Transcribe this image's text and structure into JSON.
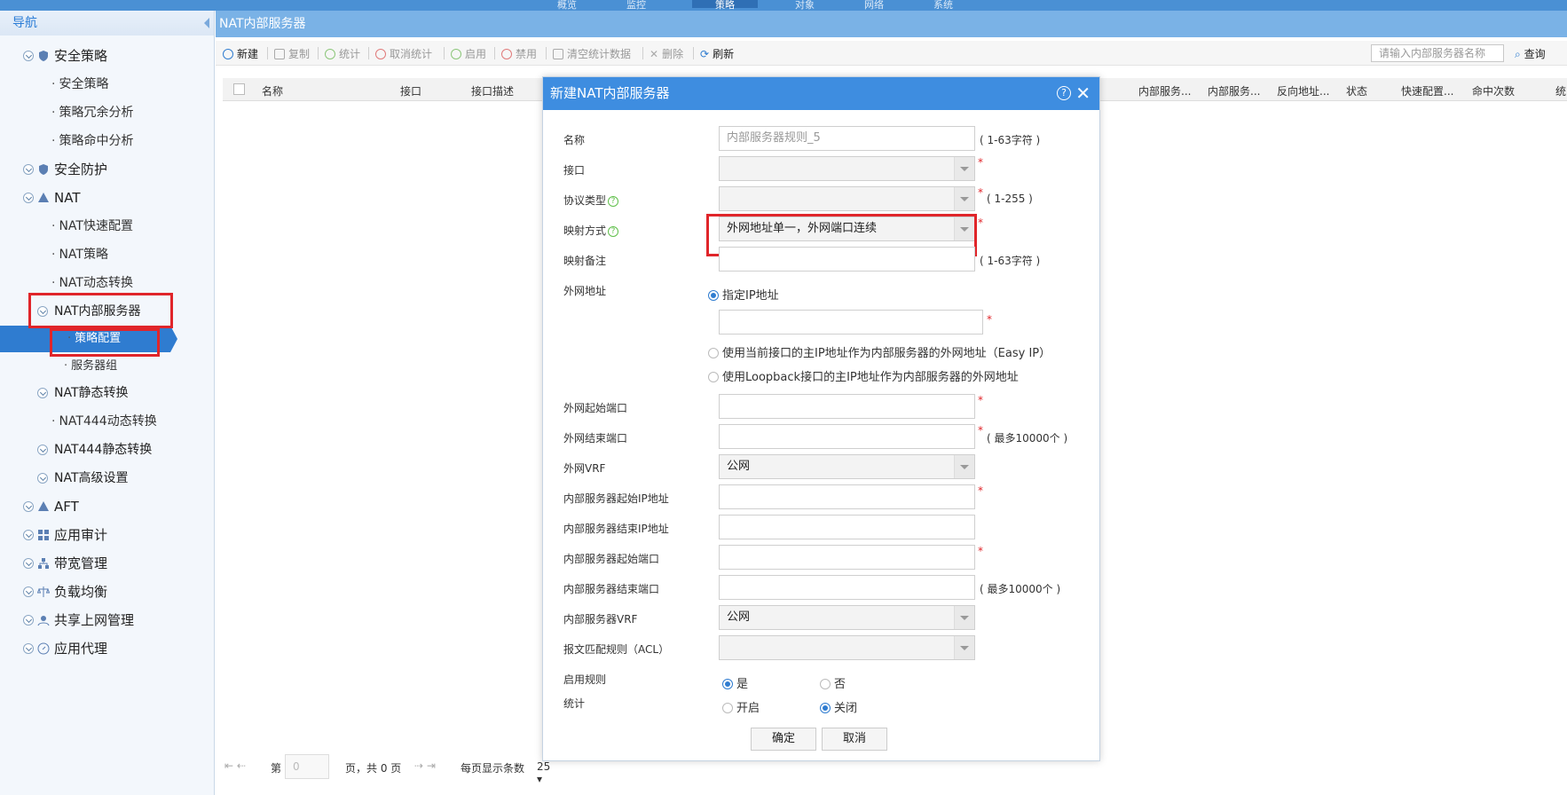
{
  "topnav": {
    "tabs": [
      "概览",
      "监控",
      "策略",
      "对象",
      "网络",
      "系统"
    ],
    "active_index": 2
  },
  "sidebar": {
    "header": "导航",
    "items": [
      {
        "label": "安全策略",
        "kind": "group"
      },
      {
        "label": "安全策略",
        "kind": "sub"
      },
      {
        "label": "策略冗余分析",
        "kind": "sub"
      },
      {
        "label": "策略命中分析",
        "kind": "sub"
      },
      {
        "label": "安全防护",
        "kind": "group"
      },
      {
        "label": "NAT",
        "kind": "group"
      },
      {
        "label": "NAT快速配置",
        "kind": "sub"
      },
      {
        "label": "NAT策略",
        "kind": "sub"
      },
      {
        "label": "NAT动态转换",
        "kind": "sub"
      },
      {
        "label": "NAT内部服务器",
        "kind": "sub-group"
      },
      {
        "label": "策略配置",
        "kind": "leaf",
        "active": true
      },
      {
        "label": "服务器组",
        "kind": "leaf"
      },
      {
        "label": "NAT静态转换",
        "kind": "sub-group"
      },
      {
        "label": "NAT444动态转换",
        "kind": "sub"
      },
      {
        "label": "NAT444静态转换",
        "kind": "sub-group"
      },
      {
        "label": "NAT高级设置",
        "kind": "sub-group"
      },
      {
        "label": "AFT",
        "kind": "group"
      },
      {
        "label": "应用审计",
        "kind": "group"
      },
      {
        "label": "带宽管理",
        "kind": "group"
      },
      {
        "label": "负载均衡",
        "kind": "group"
      },
      {
        "label": "共享上网管理",
        "kind": "group"
      },
      {
        "label": "应用代理",
        "kind": "group"
      }
    ]
  },
  "main": {
    "title": "NAT内部服务器",
    "toolbar": {
      "new": "新建",
      "copy": "复制",
      "stats": "统计",
      "cancel_stats": "取消统计",
      "enable": "启用",
      "disable": "禁用",
      "clear_stats": "清空统计数据",
      "delete": "删除",
      "refresh": "刷新",
      "search_placeholder": "请输入内部服务器名称",
      "query": "查询"
    },
    "columns": [
      "名称",
      "接口",
      "接口描述",
      "内部服务...",
      "内部服务...",
      "反向地址...",
      "状态",
      "快速配置...",
      "命中次数",
      "统"
    ],
    "pager": {
      "page_label": "第",
      "page_value": "0",
      "of_label": "页，共 0 页",
      "per_page_label": "每页显示条数",
      "per_page_value": "25"
    }
  },
  "dialog": {
    "title": "新建NAT内部服务器",
    "help": "?",
    "fields": {
      "name_label": "名称",
      "name_placeholder": "内部服务器规则_5",
      "name_hint": "( 1-63字符 )",
      "interface_label": "接口",
      "interface_value": "",
      "protocol_label": "协议类型",
      "protocol_value": "",
      "protocol_hint": "( 1-255 )",
      "mapping_label": "映射方式",
      "mapping_value": "外网地址单一，外网端口连续",
      "mapping_note_label": "映射备注",
      "mapping_note_value": "",
      "mapping_note_hint": "( 1-63字符 )",
      "ext_addr_label": "外网地址",
      "ext_addr_opt1": "指定IP地址",
      "ext_addr_value": "",
      "ext_addr_opt2": "使用当前接口的主IP地址作为内部服务器的外网地址（Easy IP）",
      "ext_addr_opt3": "使用Loopback接口的主IP地址作为内部服务器的外网地址",
      "ext_start_port_label": "外网起始端口",
      "ext_start_port_value": "",
      "ext_end_port_label": "外网结束端口",
      "ext_end_port_value": "",
      "ext_end_port_hint": "( 最多10000个 )",
      "ext_vrf_label": "外网VRF",
      "ext_vrf_value": "公网",
      "int_start_ip_label": "内部服务器起始IP地址",
      "int_start_ip_value": "",
      "int_end_ip_label": "内部服务器结束IP地址",
      "int_end_ip_value": "",
      "int_start_port_label": "内部服务器起始端口",
      "int_start_port_value": "",
      "int_end_port_label": "内部服务器结束端口",
      "int_end_port_value": "",
      "int_end_port_hint": "( 最多10000个 )",
      "int_vrf_label": "内部服务器VRF",
      "int_vrf_value": "公网",
      "acl_label": "报文匹配规则（ACL）",
      "acl_value": "",
      "enable_label": "启用规则",
      "enable_yes": "是",
      "enable_no": "否",
      "stats_label": "统计",
      "stats_on": "开启",
      "stats_off": "关闭"
    },
    "ok": "确定",
    "cancel": "取消"
  },
  "colors": {
    "accent": "#3e8de0",
    "highlight": "#e0252a",
    "nav_active": "#2f7cd0"
  }
}
